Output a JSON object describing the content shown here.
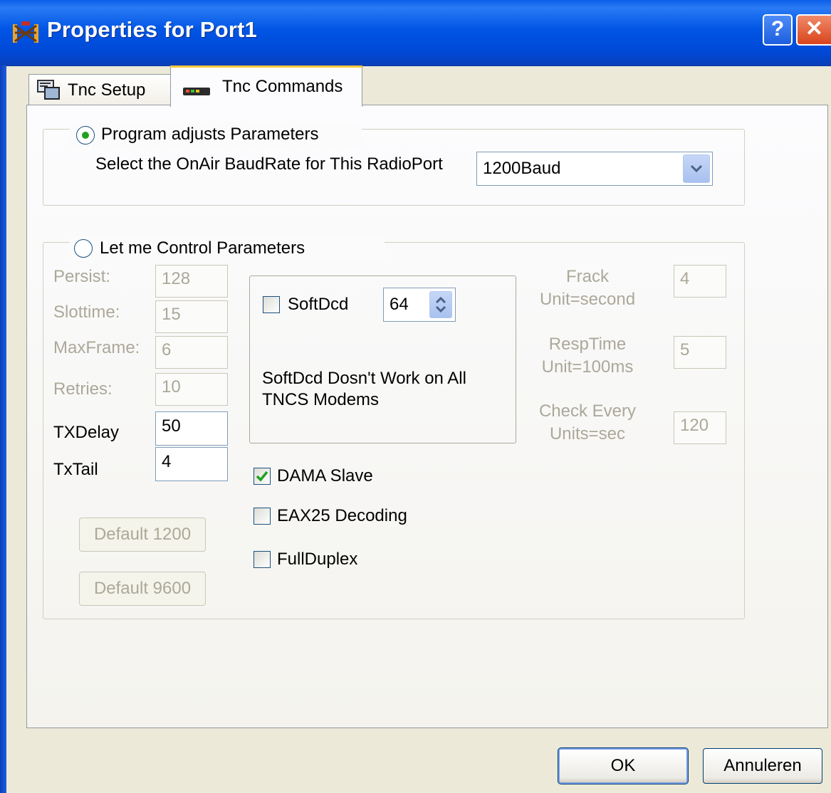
{
  "window": {
    "title": "Properties for Port1",
    "help_glyph": "?",
    "close_glyph": "✕"
  },
  "tabs": [
    {
      "label": "Tnc Setup",
      "icon": "setup-icon",
      "selected": false
    },
    {
      "label": "Tnc Commands",
      "icon": "modem-icon",
      "selected": true
    }
  ],
  "program_group": {
    "radio_label": "Program adjusts Parameters",
    "selected": true,
    "baud_label": "Select the OnAir BaudRate for This RadioPort",
    "baud_value": "1200Baud"
  },
  "manual_group": {
    "radio_label": "Let me Control Parameters",
    "selected": false,
    "fields": [
      {
        "label": "Persist:",
        "value": "128",
        "enabled": false
      },
      {
        "label": "Slottime:",
        "value": "15",
        "enabled": false
      },
      {
        "label": "MaxFrame:",
        "value": "6",
        "enabled": false
      },
      {
        "label": "Retries:",
        "value": "10",
        "enabled": false
      },
      {
        "label": "TXDelay",
        "value": "50",
        "enabled": true
      },
      {
        "label": "TxTail",
        "value": "4",
        "enabled": true
      }
    ],
    "softdcd": {
      "label": "SoftDcd",
      "checked": false,
      "spin_value": "64",
      "note_line1": "SoftDcd Dosn't Work on All",
      "note_line2": "TNCS  Modems"
    },
    "checkboxes": [
      {
        "label": "DAMA Slave",
        "checked": true
      },
      {
        "label": "EAX25 Decoding",
        "checked": false
      },
      {
        "label": "FullDuplex",
        "checked": false
      }
    ],
    "right_fields": [
      {
        "label1": "Frack",
        "label2": "Unit=second",
        "value": "4"
      },
      {
        "label1": "RespTime",
        "label2": "Unit=100ms",
        "value": "5"
      },
      {
        "label1": "Check Every",
        "label2": "Units=sec",
        "value": "120"
      }
    ],
    "default_1200_label": "Default 1200",
    "default_9600_label": "Default 9600"
  },
  "footer": {
    "ok_label": "OK",
    "cancel_label": "Annuleren"
  },
  "colors": {
    "titlebar": "#0055e5",
    "tab_highlight": "#ffc83c",
    "radio_dot": "#21a121",
    "check_mark": "#21a121"
  }
}
